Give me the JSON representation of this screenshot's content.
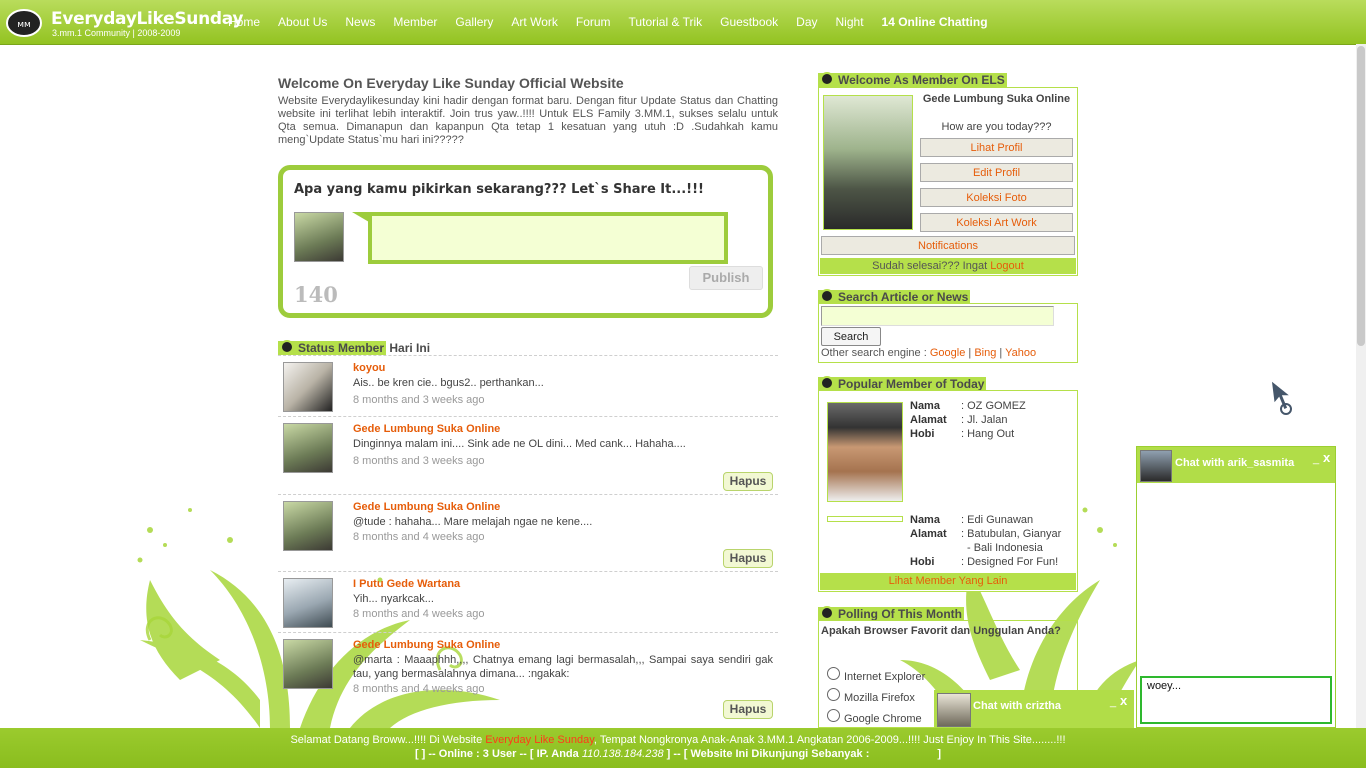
{
  "brand": {
    "title": "EverydayLikeSunday",
    "subtitle": "3.mm.1 Community | 2008-2009"
  },
  "nav": [
    "Home",
    "About Us",
    "News",
    "Member",
    "Gallery",
    "Art Work",
    "Forum",
    "Tutorial & Trik",
    "Guestbook",
    "Day",
    "Night",
    "14 Online Chatting"
  ],
  "welcome": {
    "title": "Welcome On Everyday Like Sunday Official Website",
    "text": "Website Everydaylikesunday kini hadir dengan format baru. Dengan fitur Update Status dan Chatting website ini terlihat lebih interaktif. Join trus yaw..!!!! Untuk ELS Family 3.MM.1, sukses selalu untuk Qta semua. Dimanapun dan kapanpun Qta tetap 1 kesatuan yang utuh :D .Sudahkah kamu meng`Update Status`mu hari ini?????"
  },
  "share": {
    "title": "Apa yang kamu pikirkan sekarang??? Let`s Share It...!!!",
    "publish": "Publish",
    "counter": "140"
  },
  "status_section": {
    "title_a": "Status Member",
    "title_b": " Hari Ini",
    "delete_label": "Hapus"
  },
  "statuses": [
    {
      "name": "koyou",
      "msg": "Ais.. be kren cie.. bgus2.. perthankan...",
      "time": "8 months and 3 weeks ago"
    },
    {
      "name": "Gede Lumbung Suka Online",
      "msg": "Dinginnya malam ini.... Sink ade ne OL dini... Med cank... Hahaha....",
      "time": "8 months and 3 weeks ago"
    },
    {
      "name": "Gede Lumbung Suka Online",
      "msg": "@tude : hahaha... Mare melajah ngae ne kene....",
      "time": "8 months and 4 weeks ago"
    },
    {
      "name": "I Putu Gede Wartana",
      "msg": "Yih... nyarkcak...",
      "time": "8 months and 4 weeks ago"
    },
    {
      "name": "Gede Lumbung Suka Online",
      "msg": "@marta : Maaaphhh,,,, Chatnya emang lagi bermasalah,,, Sampai saya sendiri gak tau, yang bermasalahnya dimana... :ngakak:",
      "time": "8 months and 4 weeks ago"
    }
  ],
  "member_box": {
    "title_a": "Welcome As Member On ELS",
    "user_name": "Gede Lumbung Suka Online",
    "greeting": "How are you today???",
    "buttons": [
      "Lihat Profil",
      "Edit Profil",
      "Koleksi Foto",
      "Koleksi Art Work"
    ],
    "notifications": "Notifications",
    "done_text": "Sudah selesai??? Ingat ",
    "logout": "Logout"
  },
  "search_box": {
    "title": "Search Article or News",
    "button": "Search",
    "other_label": "Other search engine : ",
    "engines": [
      "Google",
      "Bing",
      "Yahoo"
    ],
    "sep": " | "
  },
  "popular": {
    "title": "Popular Member of Today",
    "labels": [
      "Nama",
      "Alamat",
      "Hobi"
    ],
    "m1": [
      ": OZ GOMEZ",
      ": Jl. Jalan",
      ": Hang Out"
    ],
    "m2": [
      ": Edi Gunawan",
      ": Batubulan, Gianyar",
      "- Bali Indonesia",
      ": Designed For Fun!"
    ],
    "more": "Lihat Member Yang Lain"
  },
  "poll": {
    "title": "Polling Of This Month",
    "question": "Apakah Browser Favorit dan Unggulan Anda?",
    "options": [
      "Internet Explorer",
      "Mozilla Firefox",
      "Google Chrome"
    ]
  },
  "footer": {
    "l1_a": "Selamat Datang Broww...!!!! Di Website ",
    "l1_b": "Everyday Like Sunday",
    "l1_c": ", Tempat Nongkronya Anak-Anak 3.MM.1 Angkatan 2006-2009...!!!! Just Enjoy In This Site........!!!",
    "l2_a": "[ ] -- Online : ",
    "l2_b": "3 User",
    "l2_c": " -- [ IP. Anda ",
    "l2_d": "110.138.184.238",
    "l2_e": " ] -- [ Website Ini Dikunjungi Sebanyak :",
    "l2_f": "]"
  },
  "chat1": {
    "title": "Chat with arik_sasmita",
    "min": "_",
    "close": "x",
    "input": "woey..."
  },
  "chat2": {
    "title": "Chat with criztha",
    "min": "_",
    "close": "x"
  },
  "colors": {
    "accent": "#9dcc3c",
    "link": "#e65d0a",
    "header": "#93c321"
  }
}
